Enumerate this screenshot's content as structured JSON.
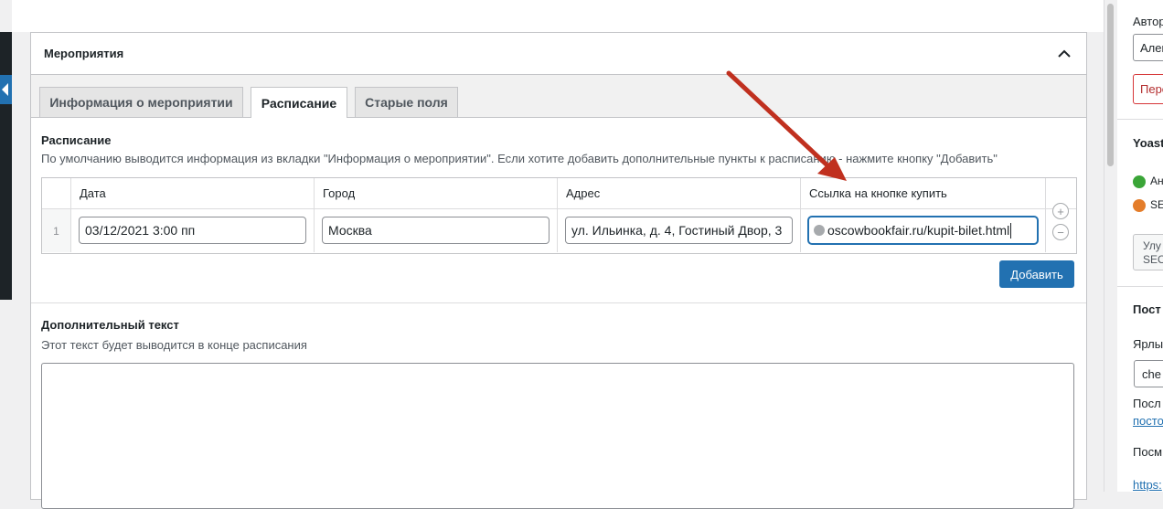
{
  "metabox": {
    "title": "Мероприятия",
    "tabs": [
      {
        "label": "Информация о мероприятии"
      },
      {
        "label": "Расписание"
      },
      {
        "label": "Старые поля"
      }
    ],
    "schedule": {
      "title": "Расписание",
      "description": "По умолчанию выводится информация из вкладки \"Информация о мероприятии\". Если хотите добавить дополнительные пункты к расписанию - нажмите кнопку \"Добавить\"",
      "columns": [
        "Дата",
        "Город",
        "Адрес",
        "Ссылка на кнопке купить"
      ],
      "rows": [
        {
          "num": "1",
          "date": "03/12/2021 3:00 пп",
          "city": "Москва",
          "address": "ул. Ильинка, д. 4, Гостиный Двор, 3",
          "link": "oscowbookfair.ru/kupit-bilet.html"
        }
      ],
      "add_row_symbol": "+",
      "remove_row_symbol": "−",
      "add_button": "Добавить"
    },
    "extra": {
      "title": "Дополнительный текст",
      "description": "Этот текст будет выводится в конце расписания"
    }
  },
  "sidebar": {
    "author_label": "Автор",
    "author_value": "Алек",
    "author_warning": "Пере",
    "yoast_title": "Yoast",
    "yoast_readability": "Ан",
    "yoast_seo": "SE",
    "yoast_button_line1": "Улу",
    "yoast_button_line2": "SEO",
    "permalink_title": "Пост",
    "slug_label": "Ярлы",
    "slug_value": "che",
    "last_label": "Посл",
    "last_link": "посто",
    "view_label": "Посм",
    "view_link": "https:"
  },
  "colors": {
    "primary": "#2271b1",
    "annotation_arrow": "#c0301f",
    "smile_green": "#3aa537",
    "smile_orange": "#e47d2a"
  }
}
